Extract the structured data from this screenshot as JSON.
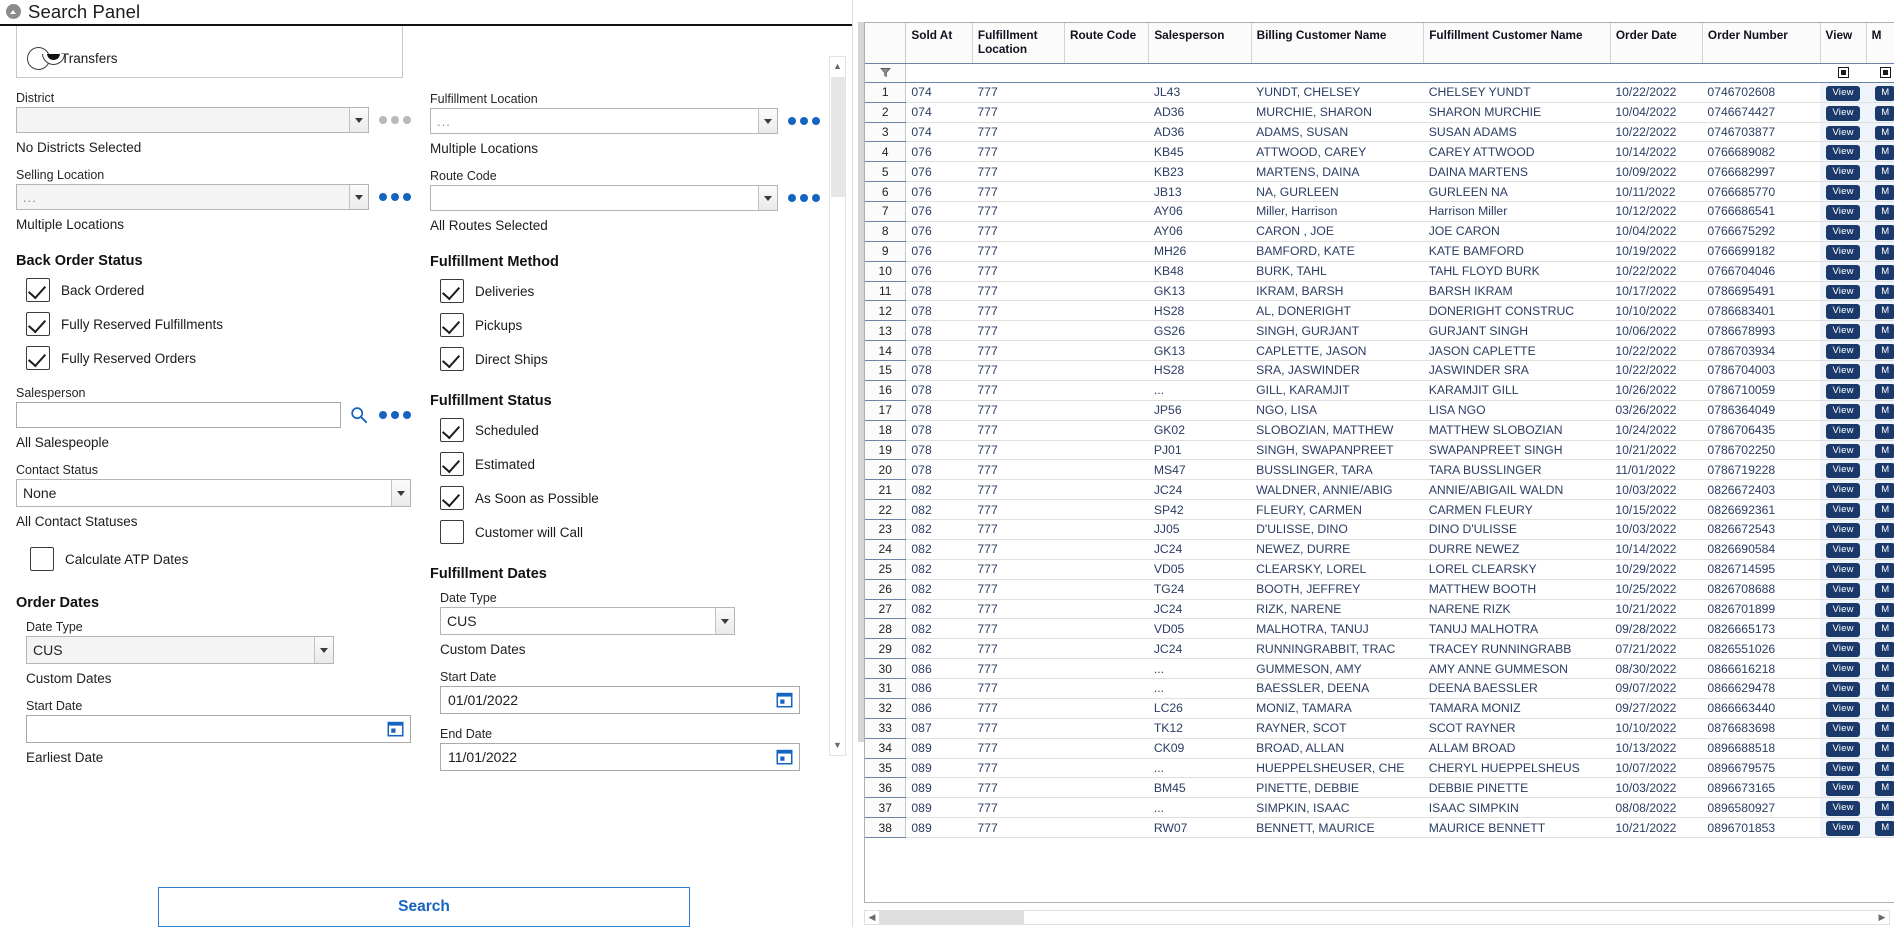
{
  "panel": {
    "title": "Search Panel",
    "collapse_icon": "chevron-up-circle-icon"
  },
  "order_type": {
    "transfers_label": "Transfers"
  },
  "fields": {
    "district": {
      "label": "District",
      "value": "",
      "hint": "No Districts Selected",
      "dots_enabled": false
    },
    "selling_location": {
      "label": "Selling Location",
      "value": "...",
      "hint": "Multiple Locations",
      "dots_enabled": true
    },
    "fulfillment_location": {
      "label": "Fulfillment Location",
      "value": "...",
      "hint": "Multiple Locations",
      "dots_enabled": true
    },
    "route_code": {
      "label": "Route Code",
      "value": "",
      "hint": "All Routes Selected",
      "dots_enabled": true
    },
    "salesperson": {
      "label": "Salesperson",
      "value": "",
      "hint": "All Salespeople",
      "search_icon": "magnifier-icon"
    },
    "contact_status": {
      "label": "Contact Status",
      "value": "None",
      "hint": "All Contact Statuses"
    },
    "calculate_atp": {
      "label": "Calculate ATP Dates",
      "checked": false
    }
  },
  "back_order_status": {
    "title": "Back Order Status",
    "items": [
      {
        "label": "Back Ordered",
        "checked": true
      },
      {
        "label": "Fully Reserved Fulfillments",
        "checked": true
      },
      {
        "label": "Fully Reserved Orders",
        "checked": true
      }
    ]
  },
  "fulfillment_method": {
    "title": "Fulfillment Method",
    "items": [
      {
        "label": "Deliveries",
        "checked": true
      },
      {
        "label": "Pickups",
        "checked": true
      },
      {
        "label": "Direct Ships",
        "checked": true
      }
    ]
  },
  "fulfillment_status": {
    "title": "Fulfillment Status",
    "items": [
      {
        "label": "Scheduled",
        "checked": true
      },
      {
        "label": "Estimated",
        "checked": true
      },
      {
        "label": "As Soon as Possible",
        "checked": true
      },
      {
        "label": "Customer will Call",
        "checked": false
      }
    ]
  },
  "order_dates": {
    "title": "Order Dates",
    "date_type_label": "Date Type",
    "date_type_value": "CUS",
    "date_type_hint": "Custom Dates",
    "start_label": "Start Date",
    "start_value": "",
    "start_hint": "Earliest Date",
    "calendar_icon": "calendar-icon"
  },
  "fulfillment_dates": {
    "title": "Fulfillment Dates",
    "date_type_label": "Date Type",
    "date_type_value": "CUS",
    "date_type_hint": "Custom Dates",
    "start_label": "Start Date",
    "start_value": "01/01/2022",
    "end_label": "End Date",
    "end_value": "11/01/2022",
    "calendar_icon": "calendar-icon"
  },
  "search_button": {
    "label": "Search"
  },
  "grid": {
    "filter_icon": "funnel-icon",
    "columns": [
      "Sold At",
      "Fulfillment Location",
      "Route Code",
      "Salesperson",
      "Billing Customer Name",
      "Fulfillment Customer Name",
      "Order Date",
      "Order Number",
      "View",
      "M"
    ],
    "view_label": "View",
    "m_label": "M",
    "rows": [
      {
        "n": "1",
        "sold_at": "074",
        "ful_loc": "777",
        "route": "",
        "sales": "JL43",
        "billing": "YUNDT, CHELSEY",
        "ful_cust": "CHELSEY YUNDT",
        "order_date": "10/22/2022",
        "order_num": "0746702608"
      },
      {
        "n": "2",
        "sold_at": "074",
        "ful_loc": "777",
        "route": "",
        "sales": "AD36",
        "billing": "MURCHIE, SHARON",
        "ful_cust": "SHARON MURCHIE",
        "order_date": "10/04/2022",
        "order_num": "0746674427"
      },
      {
        "n": "3",
        "sold_at": "074",
        "ful_loc": "777",
        "route": "",
        "sales": "AD36",
        "billing": "ADAMS, SUSAN",
        "ful_cust": "SUSAN ADAMS",
        "order_date": "10/22/2022",
        "order_num": "0746703877"
      },
      {
        "n": "4",
        "sold_at": "076",
        "ful_loc": "777",
        "route": "",
        "sales": "KB45",
        "billing": "ATTWOOD, CAREY",
        "ful_cust": "CAREY ATTWOOD",
        "order_date": "10/14/2022",
        "order_num": "0766689082"
      },
      {
        "n": "5",
        "sold_at": "076",
        "ful_loc": "777",
        "route": "",
        "sales": "KB23",
        "billing": "MARTENS, DAINA",
        "ful_cust": "DAINA MARTENS",
        "order_date": "10/09/2022",
        "order_num": "0766682997"
      },
      {
        "n": "6",
        "sold_at": "076",
        "ful_loc": "777",
        "route": "",
        "sales": "JB13",
        "billing": "NA, GURLEEN",
        "ful_cust": "GURLEEN NA",
        "order_date": "10/11/2022",
        "order_num": "0766685770"
      },
      {
        "n": "7",
        "sold_at": "076",
        "ful_loc": "777",
        "route": "",
        "sales": "AY06",
        "billing": "Miller, Harrison",
        "ful_cust": "Harrison Miller",
        "order_date": "10/12/2022",
        "order_num": "0766686541"
      },
      {
        "n": "8",
        "sold_at": "076",
        "ful_loc": "777",
        "route": "",
        "sales": "AY06",
        "billing": "CARON , JOE",
        "ful_cust": "JOE CARON",
        "order_date": "10/04/2022",
        "order_num": "0766675292"
      },
      {
        "n": "9",
        "sold_at": "076",
        "ful_loc": "777",
        "route": "",
        "sales": "MH26",
        "billing": "BAMFORD, KATE",
        "ful_cust": "KATE BAMFORD",
        "order_date": "10/19/2022",
        "order_num": "0766699182"
      },
      {
        "n": "10",
        "sold_at": "076",
        "ful_loc": "777",
        "route": "",
        "sales": "KB48",
        "billing": "BURK, TAHL",
        "ful_cust": "TAHL FLOYD BURK",
        "order_date": "10/22/2022",
        "order_num": "0766704046"
      },
      {
        "n": "11",
        "sold_at": "078",
        "ful_loc": "777",
        "route": "",
        "sales": "GK13",
        "billing": "IKRAM, BARSH",
        "ful_cust": "BARSH IKRAM",
        "order_date": "10/17/2022",
        "order_num": "0786695491"
      },
      {
        "n": "12",
        "sold_at": "078",
        "ful_loc": "777",
        "route": "",
        "sales": "HS28",
        "billing": "AL, DONERIGHT",
        "ful_cust": "DONERIGHT CONSTRUC",
        "order_date": "10/10/2022",
        "order_num": "0786683401"
      },
      {
        "n": "13",
        "sold_at": "078",
        "ful_loc": "777",
        "route": "",
        "sales": "GS26",
        "billing": "SINGH, GURJANT",
        "ful_cust": "GURJANT SINGH",
        "order_date": "10/06/2022",
        "order_num": "0786678993"
      },
      {
        "n": "14",
        "sold_at": "078",
        "ful_loc": "777",
        "route": "",
        "sales": "GK13",
        "billing": "CAPLETTE, JASON",
        "ful_cust": "JASON CAPLETTE",
        "order_date": "10/22/2022",
        "order_num": "0786703934"
      },
      {
        "n": "15",
        "sold_at": "078",
        "ful_loc": "777",
        "route": "",
        "sales": "HS28",
        "billing": "SRA, JASWINDER",
        "ful_cust": "JASWINDER SRA",
        "order_date": "10/22/2022",
        "order_num": "0786704003"
      },
      {
        "n": "16",
        "sold_at": "078",
        "ful_loc": "777",
        "route": "",
        "sales": "...",
        "billing": "GILL, KARAMJIT",
        "ful_cust": "KARAMJIT GILL",
        "order_date": "10/26/2022",
        "order_num": "0786710059"
      },
      {
        "n": "17",
        "sold_at": "078",
        "ful_loc": "777",
        "route": "",
        "sales": "JP56",
        "billing": "NGO, LISA",
        "ful_cust": "LISA NGO",
        "order_date": "03/26/2022",
        "order_num": "0786364049"
      },
      {
        "n": "18",
        "sold_at": "078",
        "ful_loc": "777",
        "route": "",
        "sales": "GK02",
        "billing": "SLOBOZIAN, MATTHEW",
        "ful_cust": "MATTHEW SLOBOZIAN",
        "order_date": "10/24/2022",
        "order_num": "0786706435"
      },
      {
        "n": "19",
        "sold_at": "078",
        "ful_loc": "777",
        "route": "",
        "sales": "PJ01",
        "billing": "SINGH, SWAPANPREET",
        "ful_cust": "SWAPANPREET SINGH",
        "order_date": "10/21/2022",
        "order_num": "0786702250"
      },
      {
        "n": "20",
        "sold_at": "078",
        "ful_loc": "777",
        "route": "",
        "sales": "MS47",
        "billing": "BUSSLINGER, TARA",
        "ful_cust": "TARA BUSSLINGER",
        "order_date": "11/01/2022",
        "order_num": "0786719228"
      },
      {
        "n": "21",
        "sold_at": "082",
        "ful_loc": "777",
        "route": "",
        "sales": "JC24",
        "billing": "WALDNER, ANNIE/ABIG",
        "ful_cust": "ANNIE/ABIGAIL WALDN",
        "order_date": "10/03/2022",
        "order_num": "0826672403"
      },
      {
        "n": "22",
        "sold_at": "082",
        "ful_loc": "777",
        "route": "",
        "sales": "SP42",
        "billing": "FLEURY, CARMEN",
        "ful_cust": "CARMEN FLEURY",
        "order_date": "10/15/2022",
        "order_num": "0826692361"
      },
      {
        "n": "23",
        "sold_at": "082",
        "ful_loc": "777",
        "route": "",
        "sales": "JJ05",
        "billing": "D'ULISSE, DINO",
        "ful_cust": "DINO D'ULISSE",
        "order_date": "10/03/2022",
        "order_num": "0826672543"
      },
      {
        "n": "24",
        "sold_at": "082",
        "ful_loc": "777",
        "route": "",
        "sales": "JC24",
        "billing": "NEWEZ, DURRE",
        "ful_cust": "DURRE NEWEZ",
        "order_date": "10/14/2022",
        "order_num": "0826690584"
      },
      {
        "n": "25",
        "sold_at": "082",
        "ful_loc": "777",
        "route": "",
        "sales": "VD05",
        "billing": "CLEARSKY, LOREL",
        "ful_cust": "LOREL CLEARSKY",
        "order_date": "10/29/2022",
        "order_num": "0826714595"
      },
      {
        "n": "26",
        "sold_at": "082",
        "ful_loc": "777",
        "route": "",
        "sales": "TG24",
        "billing": "BOOTH, JEFFREY",
        "ful_cust": "MATTHEW BOOTH",
        "order_date": "10/25/2022",
        "order_num": "0826708688"
      },
      {
        "n": "27",
        "sold_at": "082",
        "ful_loc": "777",
        "route": "",
        "sales": "JC24",
        "billing": "RIZK, NARENE",
        "ful_cust": "NARENE RIZK",
        "order_date": "10/21/2022",
        "order_num": "0826701899"
      },
      {
        "n": "28",
        "sold_at": "082",
        "ful_loc": "777",
        "route": "",
        "sales": "VD05",
        "billing": "MALHOTRA, TANUJ",
        "ful_cust": "TANUJ MALHOTRA",
        "order_date": "09/28/2022",
        "order_num": "0826665173"
      },
      {
        "n": "29",
        "sold_at": "082",
        "ful_loc": "777",
        "route": "",
        "sales": "JC24",
        "billing": "RUNNINGRABBIT, TRAC",
        "ful_cust": "TRACEY RUNNINGRABB",
        "order_date": "07/21/2022",
        "order_num": "0826551026"
      },
      {
        "n": "30",
        "sold_at": "086",
        "ful_loc": "777",
        "route": "",
        "sales": "...",
        "billing": "GUMMESON, AMY",
        "ful_cust": "AMY ANNE GUMMESON",
        "order_date": "08/30/2022",
        "order_num": "0866616218"
      },
      {
        "n": "31",
        "sold_at": "086",
        "ful_loc": "777",
        "route": "",
        "sales": "...",
        "billing": "BAESSLER, DEENA",
        "ful_cust": "DEENA BAESSLER",
        "order_date": "09/07/2022",
        "order_num": "0866629478"
      },
      {
        "n": "32",
        "sold_at": "086",
        "ful_loc": "777",
        "route": "",
        "sales": "LC26",
        "billing": "MONIZ, TAMARA",
        "ful_cust": "TAMARA MONIZ",
        "order_date": "09/27/2022",
        "order_num": "0866663440"
      },
      {
        "n": "33",
        "sold_at": "087",
        "ful_loc": "777",
        "route": "",
        "sales": "TK12",
        "billing": "RAYNER, SCOT",
        "ful_cust": "SCOT RAYNER",
        "order_date": "10/10/2022",
        "order_num": "0876683698"
      },
      {
        "n": "34",
        "sold_at": "089",
        "ful_loc": "777",
        "route": "",
        "sales": "CK09",
        "billing": "BROAD, ALLAN",
        "ful_cust": "ALLAM BROAD",
        "order_date": "10/13/2022",
        "order_num": "0896688518"
      },
      {
        "n": "35",
        "sold_at": "089",
        "ful_loc": "777",
        "route": "",
        "sales": "...",
        "billing": "HUEPPELSHEUSER, CHE",
        "ful_cust": "CHERYL HUEPPELSHEUS",
        "order_date": "10/07/2022",
        "order_num": "0896679575"
      },
      {
        "n": "36",
        "sold_at": "089",
        "ful_loc": "777",
        "route": "",
        "sales": "BM45",
        "billing": "PINETTE, DEBBIE",
        "ful_cust": "DEBBIE PINETTE",
        "order_date": "10/03/2022",
        "order_num": "0896673165"
      },
      {
        "n": "37",
        "sold_at": "089",
        "ful_loc": "777",
        "route": "",
        "sales": "...",
        "billing": "SIMPKIN, ISAAC",
        "ful_cust": "ISAAC SIMPKIN",
        "order_date": "08/08/2022",
        "order_num": "0896580927"
      },
      {
        "n": "38",
        "sold_at": "089",
        "ful_loc": "777",
        "route": "",
        "sales": "RW07",
        "billing": "BENNETT, MAURICE",
        "ful_cust": "MAURICE BENNETT",
        "order_date": "10/21/2022",
        "order_num": "0896701853"
      }
    ]
  },
  "colors": {
    "accent": "#1565c0",
    "grid_text": "#2c3c62",
    "view_button": "#1b3a6b",
    "header_rule": "#6b84a8"
  }
}
